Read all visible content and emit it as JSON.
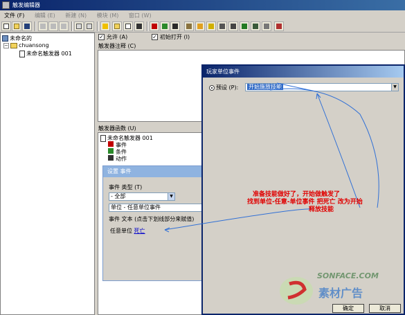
{
  "window": {
    "title": "触发编辑器"
  },
  "menu": [
    {
      "label": "文件 (F)",
      "enabled": true
    },
    {
      "label": "编辑 (E)",
      "enabled": false
    },
    {
      "label": "新建 (N)",
      "enabled": false
    },
    {
      "label": "模块 (M)",
      "enabled": false
    },
    {
      "label": "窗口 (W)",
      "enabled": false
    }
  ],
  "toolbar": {
    "icons": [
      "new-icon",
      "open-icon",
      "save-icon",
      "cut-icon",
      "copy-icon",
      "paste-icon",
      "undo-icon",
      "redo-icon",
      "close-x-icon",
      "folder-icon",
      "doc-icon",
      "script-icon",
      "flag-icon",
      "green-icon",
      "trigger-icon",
      "terrain-icon",
      "unit-icon",
      "sound-icon",
      "object-icon",
      "ai-icon",
      "camera-icon",
      "map-icon",
      "campaign-icon",
      "import-icon",
      "test-map-icon"
    ]
  },
  "tree": {
    "root": "未命名的",
    "folder": "chuansong",
    "trigger": "未命名触发器 001"
  },
  "trigger_options": {
    "enabled_label": "允许 (A)",
    "initially_on_label": "初始打开 (I)",
    "enabled_checked": true,
    "initially_on_checked": true
  },
  "comment_label": "触发器注释 (C)",
  "functions": {
    "label": "触发器函数 (U)",
    "trigger_name": "未命名触发器 001",
    "items": [
      "事件",
      "条件",
      "动作"
    ]
  },
  "settings_dialog": {
    "title": "设置 事件",
    "type_label": "事件 类型 (T)",
    "type_value": "- 全部",
    "event_value": "单位 - 任意单位事件",
    "text_label": "事件 文本 (点击下划线部分来赋值)",
    "text_prefix": "任意单位",
    "text_link": "死亡"
  },
  "player_dialog": {
    "title": "玩家单位事件",
    "preset_label": "预设 (P):",
    "preset_value": "开始施放技能",
    "ok_label": "确定",
    "cancel_label": "取消"
  },
  "annotation": {
    "line1": "准备技能做好了，开始做触发了",
    "line2": "找到单位-任意-单位事件  把死亡   改为开始",
    "line3": "释放技能",
    "color": "#e00000"
  },
  "watermark": {
    "text": "SONFACE.COM",
    "brand": "素材广告"
  }
}
